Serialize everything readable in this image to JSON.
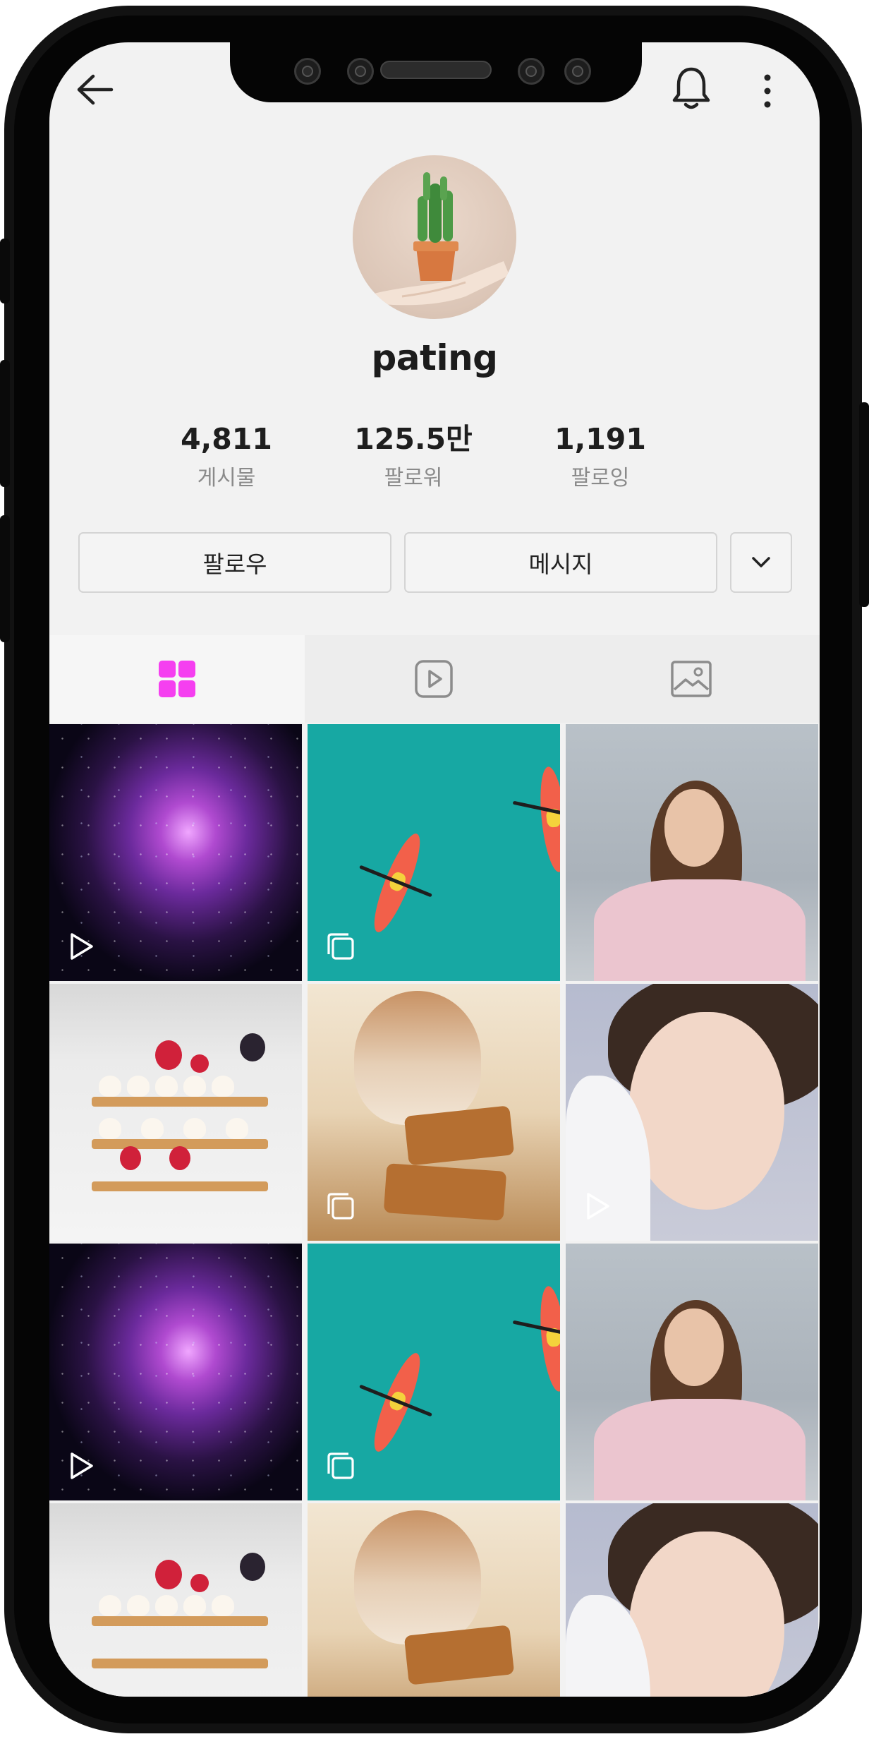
{
  "profile": {
    "username": "pating",
    "stats": [
      {
        "value": "4,811",
        "label": "게시물"
      },
      {
        "value": "125.5만",
        "label": "팔로워"
      },
      {
        "value": "1,191",
        "label": "팔로잉"
      }
    ]
  },
  "actions": {
    "follow_label": "팔로우",
    "message_label": "메시지"
  },
  "tabs": [
    {
      "icon": "grid-icon",
      "active": true
    },
    {
      "icon": "video-play-icon",
      "active": false
    },
    {
      "icon": "image-icon",
      "active": false
    }
  ],
  "grid": [
    {
      "photo": "nebula",
      "badge": "play-icon"
    },
    {
      "photo": "kayak-ocean",
      "badge": "multi-image-icon"
    },
    {
      "photo": "woman-portrait",
      "badge": ""
    },
    {
      "photo": "raspberry-cake",
      "badge": ""
    },
    {
      "photo": "coffee-lotus",
      "badge": "multi-image-icon"
    },
    {
      "photo": "woman-closeup",
      "badge": "play-icon"
    },
    {
      "photo": "nebula",
      "badge": "play-icon"
    },
    {
      "photo": "kayak-ocean",
      "badge": "multi-image-icon"
    },
    {
      "photo": "woman-portrait",
      "badge": ""
    },
    {
      "photo": "raspberry-cake",
      "badge": ""
    },
    {
      "photo": "coffee-lotus",
      "badge": ""
    },
    {
      "photo": "woman-closeup",
      "badge": ""
    }
  ],
  "colors": {
    "accent": "#f53ff0",
    "screen_bg": "#f2f2f2",
    "frame": "#121212"
  }
}
